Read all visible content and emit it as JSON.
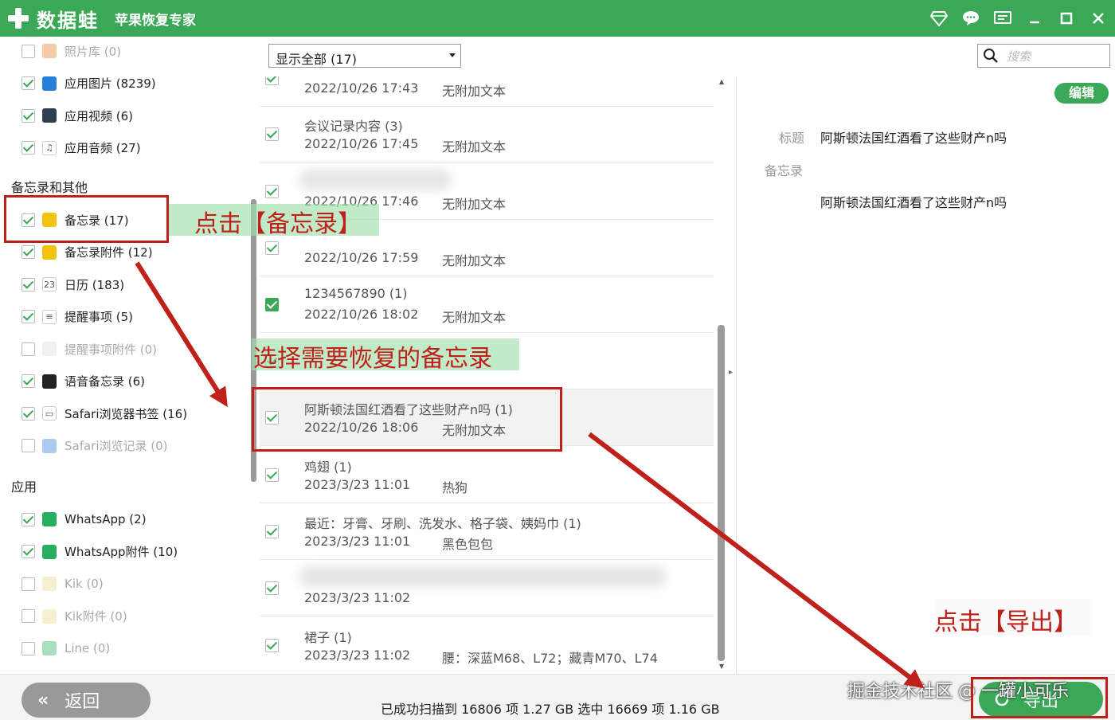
{
  "colors": {
    "accent": "#3aa857",
    "annotation": "#c0201a"
  },
  "titlebar": {
    "brand": "数据蛙",
    "subtitle": "苹果恢复专家",
    "icons": [
      "diamond-icon",
      "chat-icon",
      "feedback-icon",
      "minimize-icon",
      "maximize-icon",
      "close-icon"
    ]
  },
  "sidebar": {
    "items_top": [
      {
        "label": "照片库 (0)",
        "checked": false,
        "dim": true,
        "icon": "photo-library-icon"
      },
      {
        "label": "应用图片 (8239)",
        "checked": true,
        "dim": false,
        "icon": "app-image-icon"
      },
      {
        "label": "应用视频 (6)",
        "checked": true,
        "dim": false,
        "icon": "app-video-icon"
      },
      {
        "label": "应用音频 (27)",
        "checked": true,
        "dim": false,
        "icon": "app-audio-icon"
      }
    ],
    "section_notes": "备忘录和其他",
    "items_notes": [
      {
        "label": "备忘录 (17)",
        "checked": true,
        "dim": false,
        "icon": "notes-icon"
      },
      {
        "label": "备忘录附件 (12)",
        "checked": true,
        "dim": false,
        "icon": "notes-attachment-icon"
      },
      {
        "label": "日历 (183)",
        "checked": true,
        "dim": false,
        "icon": "calendar-icon"
      },
      {
        "label": "提醒事项 (5)",
        "checked": true,
        "dim": false,
        "icon": "reminders-icon"
      },
      {
        "label": "提醒事项附件 (0)",
        "checked": false,
        "dim": true,
        "icon": "reminders-attachment-icon"
      },
      {
        "label": "语音备忘录 (6)",
        "checked": true,
        "dim": false,
        "icon": "voice-memo-icon"
      },
      {
        "label": "Safari浏览器书签 (16)",
        "checked": true,
        "dim": false,
        "icon": "safari-bookmark-icon"
      },
      {
        "label": "Safari浏览记录 (0)",
        "checked": false,
        "dim": true,
        "icon": "safari-history-icon"
      }
    ],
    "section_apps": "应用",
    "items_apps": [
      {
        "label": "WhatsApp (2)",
        "checked": true,
        "dim": false,
        "icon": "whatsapp-icon"
      },
      {
        "label": "WhatsApp附件 (10)",
        "checked": true,
        "dim": false,
        "icon": "whatsapp-attachment-icon"
      },
      {
        "label": "Kik (0)",
        "checked": false,
        "dim": true,
        "icon": "kik-icon"
      },
      {
        "label": "Kik附件 (0)",
        "checked": false,
        "dim": true,
        "icon": "kik-attachment-icon"
      },
      {
        "label": "Line (0)",
        "checked": false,
        "dim": true,
        "icon": "line-icon"
      }
    ]
  },
  "filter": {
    "selected": "显示全部 (17)"
  },
  "list": {
    "rows": [
      {
        "title": "",
        "date": "2022/10/26 17:43",
        "note": "无附加文本",
        "checked": true
      },
      {
        "title": "会议记录内容 (3)",
        "date": "2022/10/26 17:45",
        "note": "无附加文本",
        "checked": true
      },
      {
        "title": "",
        "date": "2022/10/26 17:46",
        "note": "无附加文本",
        "checked": true,
        "blurred_title": true
      },
      {
        "title": "",
        "date": "2022/10/26 17:59",
        "note": "无附加文本",
        "checked": true
      },
      {
        "title": "1234567890 (1)",
        "date": "2022/10/26 18:02",
        "note": "无附加文本",
        "checked": true,
        "solid": true
      },
      {
        "title": "",
        "date": "",
        "note": "",
        "checked": true,
        "hidden": true
      },
      {
        "title": "阿斯顿法国红酒看了这些财产n吗 (1)",
        "date": "2022/10/26 18:06",
        "note": "无附加文本",
        "checked": true,
        "selected": true
      },
      {
        "title": "鸡翅 (1)",
        "date": "2023/3/23 11:01",
        "note": "热狗",
        "checked": true
      },
      {
        "title": "最近：牙膏、牙刷、洗发水、格子袋、姨妈巾 (1)",
        "date": "2023/3/23 11:01",
        "note": "黑色包包",
        "checked": true
      },
      {
        "title": "",
        "date": "2023/3/23 11:02",
        "note": "",
        "checked": true,
        "blurred_title": true
      },
      {
        "title": "裙子 (1)",
        "date": "2023/3/23 11:02",
        "note": "腰：深蓝M68、L72；藏青M70、L74",
        "checked": true
      }
    ]
  },
  "search": {
    "placeholder": "搜索"
  },
  "detail": {
    "edit_label": "编辑",
    "title_label": "标题",
    "title_value": "阿斯顿法国红酒看了这些财产n吗",
    "notes_label": "备忘录",
    "notes_value": "阿斯顿法国红酒看了这些财产n吗"
  },
  "footer": {
    "back_label": "返回",
    "status": "已成功扫描到 16806 项 1.27 GB  选中 16669 项 1.16 GB",
    "export_label": "导出",
    "watermark": "掘金技术社区 @ 一罐小可乐"
  },
  "annotations": {
    "click_notes": "点击【备忘录】",
    "select_notes": "选择需要恢复的备忘录",
    "click_export": "点击【导出】"
  }
}
